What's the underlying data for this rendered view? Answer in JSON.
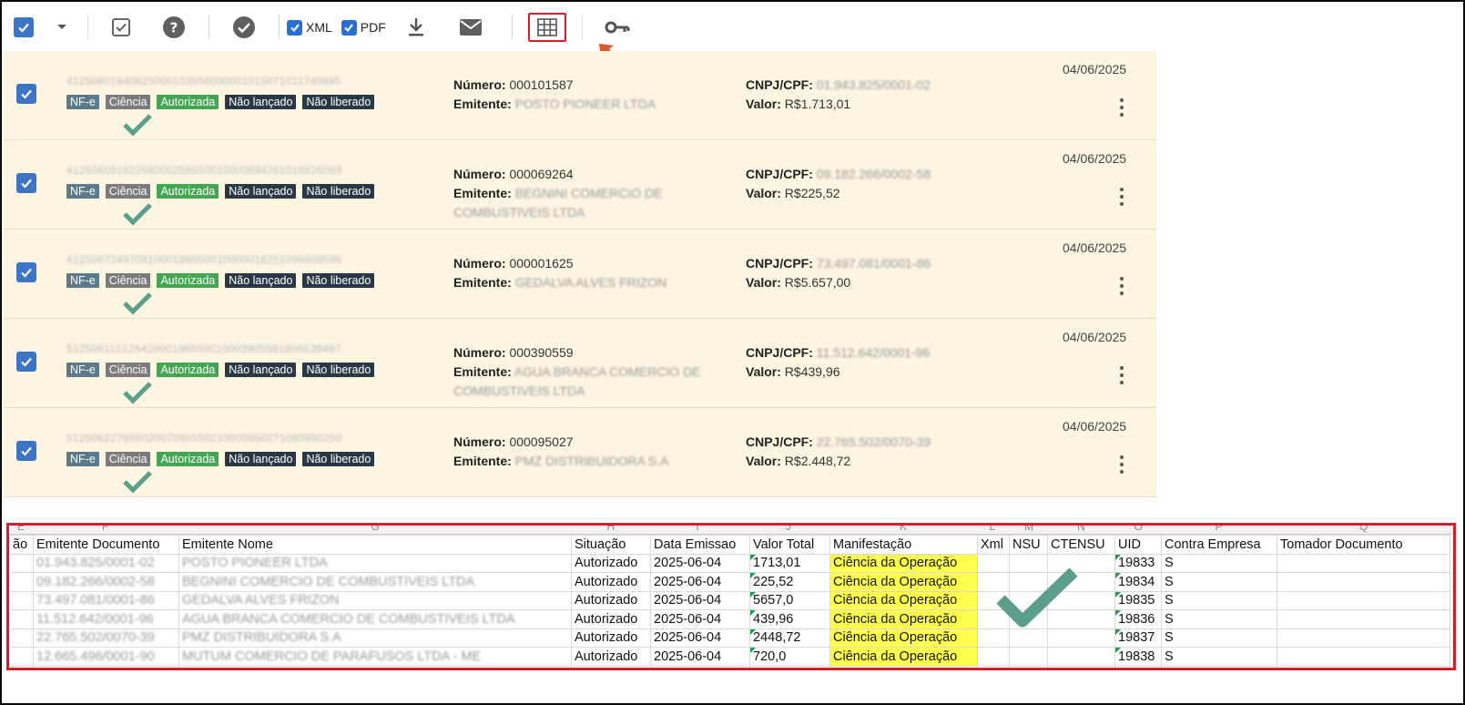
{
  "toolbar": {
    "xml_label": "XML",
    "pdf_label": "PDF"
  },
  "rows": [
    {
      "key": "41250601940825000103550030001015871011740895",
      "badges": [
        "NF-e",
        "Ciência",
        "Autorizada",
        "Não lançado",
        "Não liberado"
      ],
      "numero_label": "Número:",
      "numero": "000101587",
      "emitente_label": "Emitente:",
      "emitente": "POSTO PIONEER LTDA",
      "cnpj_label": "CNPJ/CPF:",
      "cnpj": "01.943.825/0001-02",
      "valor_label": "Valor:",
      "valor": "R$1.713,01",
      "date": "04/06/2025"
    },
    {
      "key": "41250609182266000258550010000694261016826069",
      "badges": [
        "NF-e",
        "Ciência",
        "Autorizada",
        "Não lançado",
        "Não liberado"
      ],
      "numero_label": "Número:",
      "numero": "000069264",
      "emitente_label": "Emitente:",
      "emitente": "BEGNINI COMERCIO DE COMBUSTIVEIS LTDA",
      "cnpj_label": "CNPJ/CPF:",
      "cnpj": "09.182.266/0002-58",
      "valor_label": "Valor:",
      "valor": "R$225,52",
      "date": "04/06/2025"
    },
    {
      "key": "41250673497081000186550010000016251096809595",
      "badges": [
        "NF-e",
        "Ciência",
        "Autorizada",
        "Não lançado",
        "Não liberado"
      ],
      "numero_label": "Número:",
      "numero": "000001625",
      "emitente_label": "Emitente:",
      "emitente": "GEDALVA ALVES FRIZON",
      "cnpj_label": "CNPJ/CPF:",
      "cnpj": "73.497.081/0001-86",
      "valor_label": "Valor:",
      "valor": "R$5.657,00",
      "date": "04/06/2025"
    },
    {
      "key": "51250611512642000196550010003905591806539487",
      "badges": [
        "NF-e",
        "Ciência",
        "Autorizada",
        "Não lançado",
        "Não liberado"
      ],
      "numero_label": "Número:",
      "numero": "000390559",
      "emitente_label": "Emitente:",
      "emitente": "AGUA BRANCA COMERCIO DE COMBUSTIVEIS LTDA",
      "cnpj_label": "CNPJ/CPF:",
      "cnpj": "11.512.642/0001-96",
      "valor_label": "Valor:",
      "valor": "R$439,96",
      "date": "04/06/2025"
    },
    {
      "key": "51250622765502007095550210000950271080950250",
      "badges": [
        "NF-e",
        "Ciência",
        "Autorizada",
        "Não lançado",
        "Não liberado"
      ],
      "numero_label": "Número:",
      "numero": "000095027",
      "emitente_label": "Emitente:",
      "emitente": "PMZ DISTRIBUIDORA S.A",
      "cnpj_label": "CNPJ/CPF:",
      "cnpj": "22.765.502/0070-39",
      "valor_label": "Valor:",
      "valor": "R$2.448,72",
      "date": "04/06/2025"
    }
  ],
  "sheet": {
    "col_letters": [
      "E",
      "F",
      "G",
      "H",
      "I",
      "J",
      "K",
      "L",
      "M",
      "N",
      "O",
      "P",
      "Q"
    ],
    "headers": [
      "ão",
      "Emitente Documento",
      "Emitente Nome",
      "Situação",
      "Data Emissao",
      "Valor Total",
      "Manifestação",
      "Xml",
      "NSU",
      "CTENSU",
      "UID",
      "Contra Empresa",
      "Tomador Documento"
    ],
    "rows": [
      [
        "",
        "01.943.825/0001-02",
        "POSTO PIONEER LTDA",
        "Autorizado",
        "2025-06-04",
        "1713,01",
        "Ciência da Operação",
        "",
        "",
        "",
        "19833",
        "S",
        ""
      ],
      [
        "",
        "09.182.266/0002-58",
        "BEGNINI COMERCIO DE COMBUSTIVEIS LTDA",
        "Autorizado",
        "2025-06-04",
        "225,52",
        "Ciência da Operação",
        "",
        "",
        "",
        "19834",
        "S",
        ""
      ],
      [
        "",
        "73.497.081/0001-86",
        "GEDALVA ALVES FRIZON",
        "Autorizado",
        "2025-06-04",
        "5657,0",
        "Ciência da Operação",
        "",
        "",
        "",
        "19835",
        "S",
        ""
      ],
      [
        "",
        "11.512.642/0001-96",
        "AGUA BRANCA COMERCIO DE COMBUSTIVEIS LTDA",
        "Autorizado",
        "2025-06-04",
        "439,96",
        "Ciência da Operação",
        "",
        "",
        "",
        "19836",
        "S",
        ""
      ],
      [
        "",
        "22.765.502/0070-39",
        "PMZ DISTRIBUIDORA S.A",
        "Autorizado",
        "2025-06-04",
        "2448,72",
        "Ciência da Operação",
        "",
        "",
        "",
        "19837",
        "S",
        ""
      ],
      [
        "",
        "12.665.496/0001-90",
        "MUTUM COMERCIO DE PARAFUSOS LTDA - ME",
        "Autorizado",
        "2025-06-04",
        "720,0",
        "Ciência da Operação",
        "",
        "",
        "",
        "19838",
        "S",
        ""
      ]
    ]
  },
  "colors": {
    "accent": "#3d74c4",
    "row_bg": "#fbf5e2",
    "authorized_green": "#44a652",
    "check_teal": "#5a9e8b",
    "highlight_red": "#d32027",
    "manifest_yellow": "#ffff4d"
  },
  "icons": [
    "select-all-checkbox",
    "dropdown-caret-icon",
    "checklist-icon",
    "help-icon",
    "check-circle-icon",
    "download-icon",
    "mail-icon",
    "grid-table-icon",
    "key-icon",
    "arrow-pointer-icon",
    "checkmark-icon",
    "kebab-menu-icon"
  ]
}
